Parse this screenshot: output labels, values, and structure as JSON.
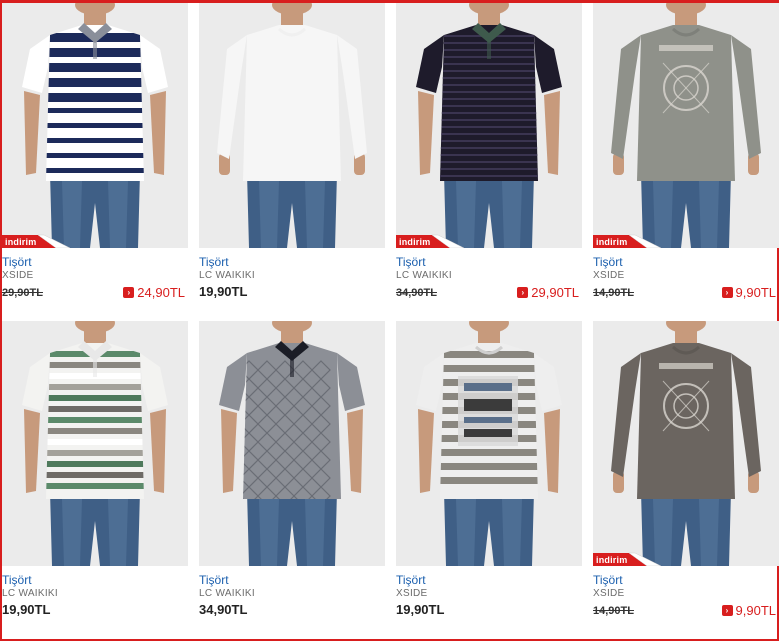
{
  "sale_badge": "indirim",
  "currency_suffix": "TL",
  "colors": {
    "accent": "#d81e1e",
    "link": "#1b5fae",
    "brand_text": "#6b6b6b"
  },
  "products": [
    {
      "category": "Tişört",
      "brand": "XSIDE",
      "old_price": "29,90TL",
      "price": "24,90TL",
      "on_sale": true,
      "shirt": "navy-white striped polo"
    },
    {
      "category": "Tişört",
      "brand": "LC WAIKIKI",
      "old_price": "",
      "price": "19,90TL",
      "on_sale": false,
      "shirt": "white long sleeve"
    },
    {
      "category": "Tişört",
      "brand": "LC WAIKIKI",
      "old_price": "34,90TL",
      "price": "29,90TL",
      "on_sale": true,
      "shirt": "dark striped polo"
    },
    {
      "category": "Tişört",
      "brand": "XSIDE",
      "old_price": "14,90TL",
      "price": "9,90TL",
      "on_sale": true,
      "shirt": "grey long sleeve print"
    },
    {
      "category": "Tişört",
      "brand": "LC WAIKIKI",
      "old_price": "",
      "price": "19,90TL",
      "on_sale": false,
      "shirt": "green-grey striped polo"
    },
    {
      "category": "Tişört",
      "brand": "LC WAIKIKI",
      "old_price": "",
      "price": "34,90TL",
      "on_sale": false,
      "shirt": "grey argyle polo"
    },
    {
      "category": "Tişört",
      "brand": "XSIDE",
      "old_price": "",
      "price": "19,90TL",
      "on_sale": false,
      "shirt": "striped graphic tee"
    },
    {
      "category": "Tişört",
      "brand": "XSIDE",
      "old_price": "14,90TL",
      "price": "9,90TL",
      "on_sale": true,
      "shirt": "brown long sleeve print"
    }
  ]
}
